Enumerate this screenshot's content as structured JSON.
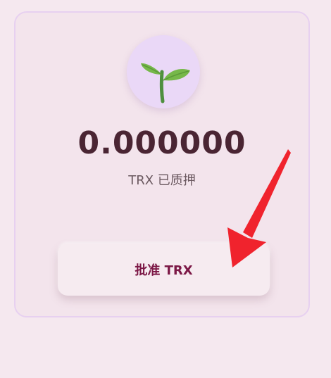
{
  "stake_card": {
    "amount": "0.000000",
    "staked_label": "TRX 已质押",
    "approve_button_label": "批准 TRX",
    "icon": "sprout-icon"
  },
  "colors": {
    "page_background": "#f5e8ef",
    "card_border": "#e7d0f0",
    "icon_circle": "#ead8f7",
    "amount_text": "#4a2533",
    "button_text": "#7c1846",
    "annotation_arrow": "#f0232d"
  },
  "annotation": {
    "type": "red-arrow",
    "points_to": "approve-button"
  }
}
